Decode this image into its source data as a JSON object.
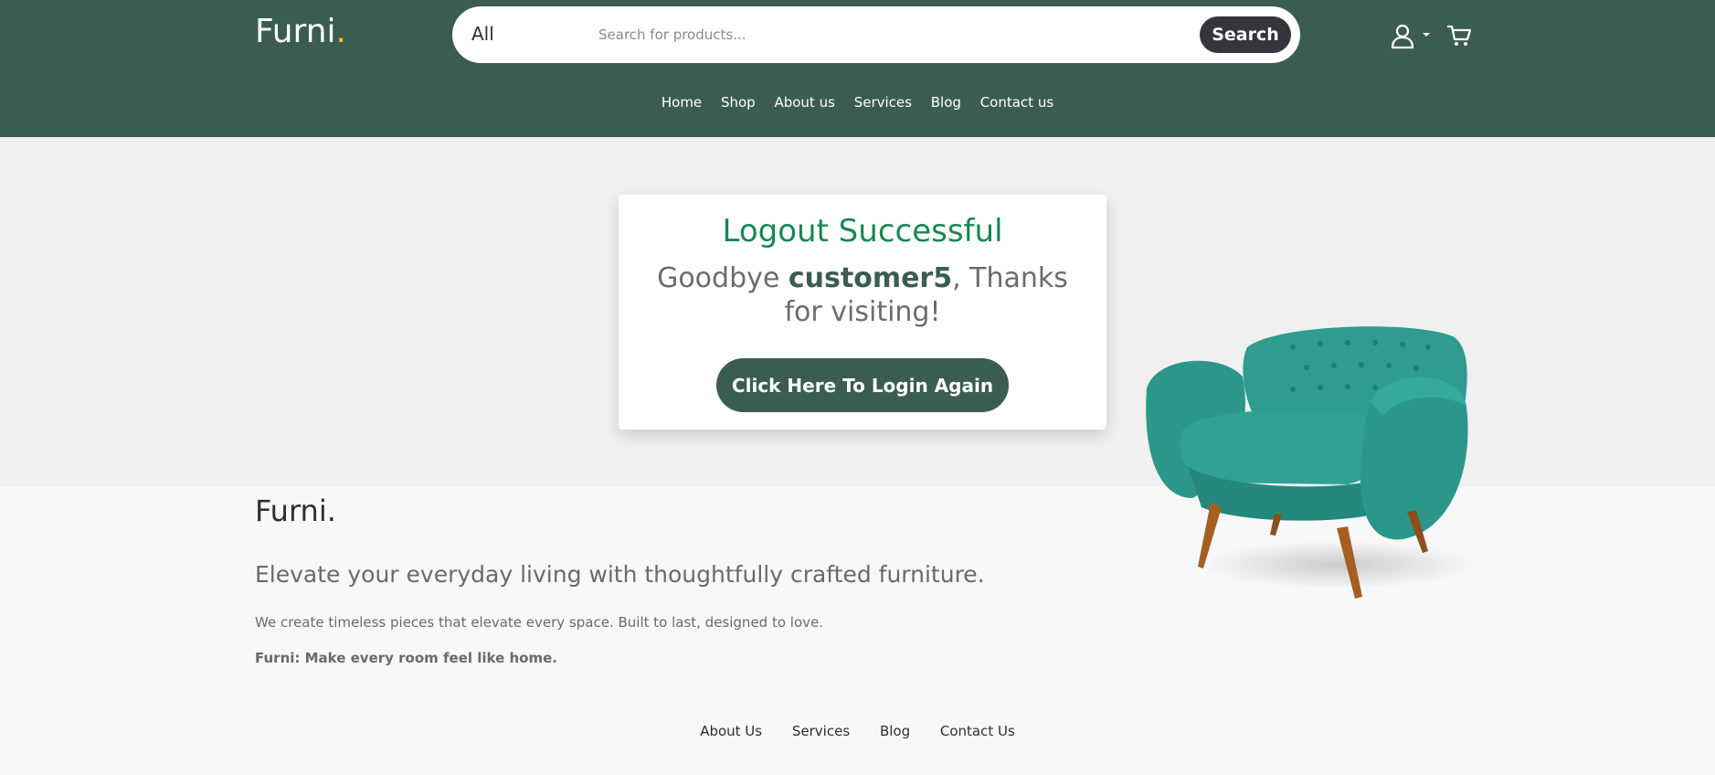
{
  "header": {
    "logo_text": "Furni",
    "logo_dot": ".",
    "search": {
      "category": "All",
      "placeholder": "Search for products...",
      "button_label": "Search"
    },
    "nav": [
      "Home",
      "Shop",
      "About us",
      "Services",
      "Blog",
      "Contact us"
    ],
    "icons": [
      "user-icon",
      "caret-down-icon",
      "cart-icon"
    ]
  },
  "card": {
    "title": "Logout Successful",
    "message_prefix": "Goodbye ",
    "username": "customer5",
    "message_suffix": ", Thanks for visiting!",
    "button_label": "Click Here To Login Again"
  },
  "footer": {
    "logo": "Furni.",
    "tagline": "Elevate your everyday living with thoughtfully crafted furniture.",
    "description": "We create timeless pieces that elevate every space. Built to last, designed to love.",
    "motto": "Furni: Make every room feel like home.",
    "links": [
      "About Us",
      "Services",
      "Blog",
      "Contact Us"
    ]
  },
  "colors": {
    "brand_green": "#3b5d50",
    "accent_yellow": "#f9bf29",
    "success_green": "#198754",
    "hero_bg": "#eff0ef",
    "footer_bg": "#f7f8f9"
  }
}
